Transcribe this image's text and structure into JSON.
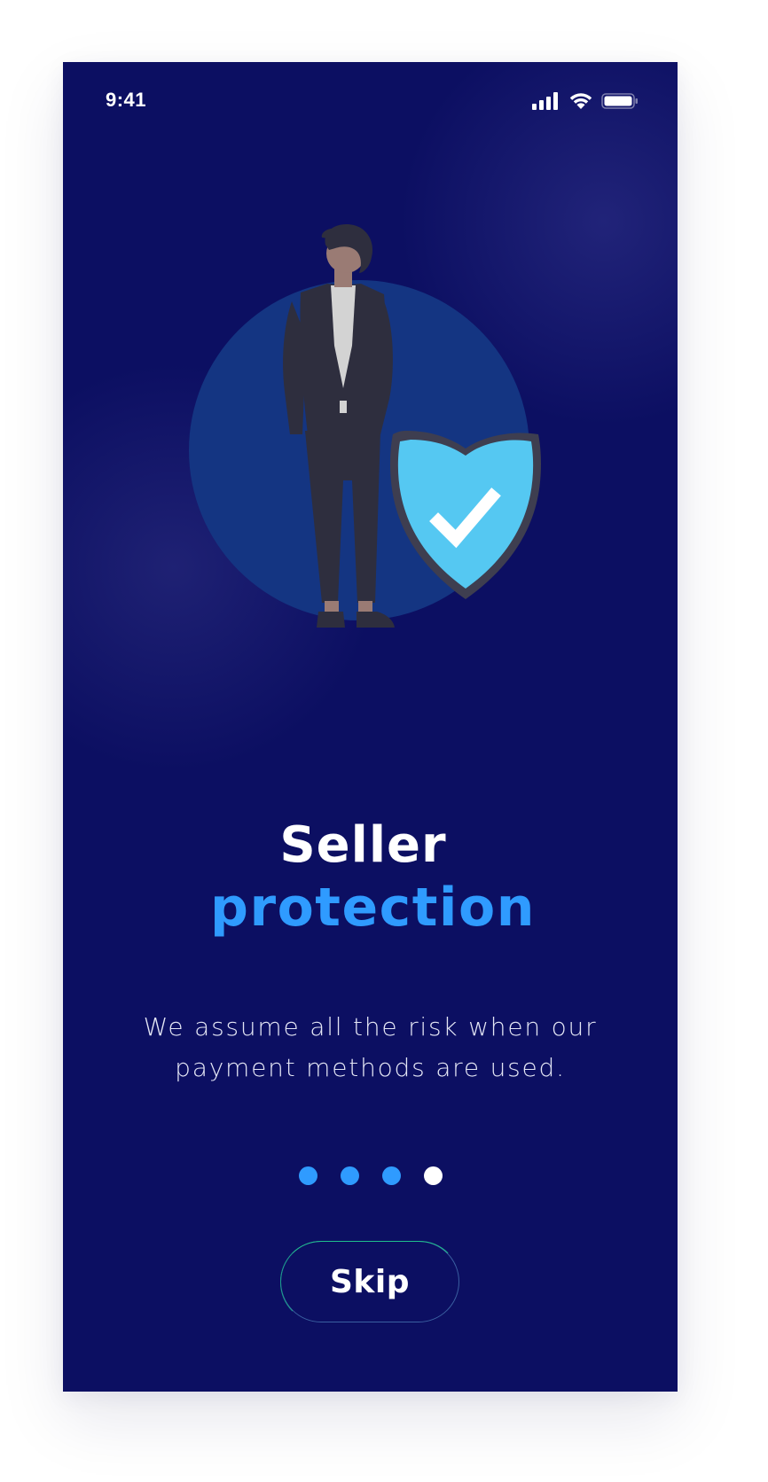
{
  "status_bar": {
    "time": "9:41",
    "icons": [
      "cellular-signal-icon",
      "wifi-icon",
      "battery-icon"
    ]
  },
  "onboarding": {
    "illustration": "person-with-shield-illustration",
    "title_line1": "Seller",
    "title_line2": "protection",
    "description": "We assume all the risk when our payment methods are used.",
    "page_indicator": {
      "count": 4,
      "active_index": 3
    },
    "skip_label": "Skip"
  },
  "colors": {
    "background": "#0c0f62",
    "accent": "#2f9bff",
    "shield": "#55c8f2",
    "button_border": "#1fc08d"
  }
}
